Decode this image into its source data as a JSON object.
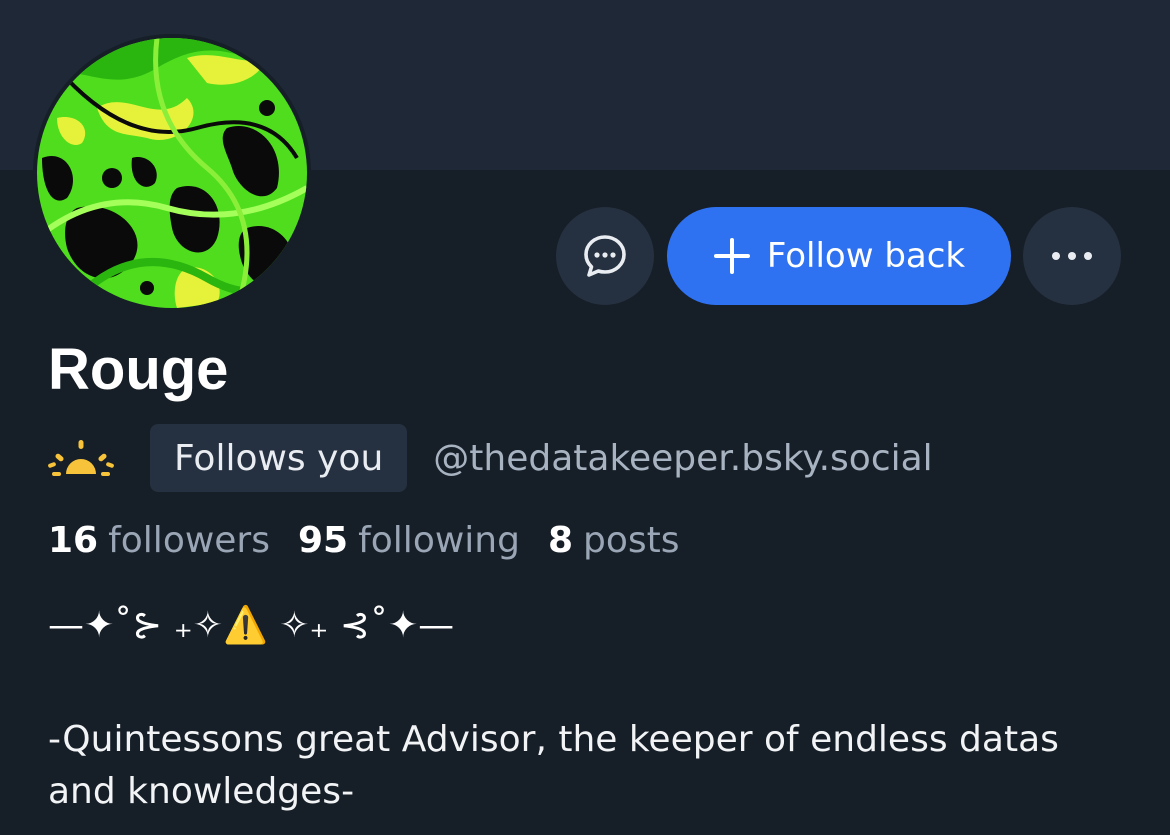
{
  "profile": {
    "display_name": "Rouge",
    "handle": "@thedatakeeper.bsky.social",
    "follows_you_label": "Follows you",
    "avatar_icon": "abstract-green-avatar",
    "status_icon": "sunrise-icon"
  },
  "actions": {
    "message_icon": "chat-bubble-icon",
    "follow_label": "Follow back",
    "follow_icon": "plus-icon",
    "more_icon": "ellipsis-icon"
  },
  "stats": {
    "followers_count": "16",
    "followers_label": "followers",
    "following_count": "95",
    "following_label": "following",
    "posts_count": "8",
    "posts_label": "posts"
  },
  "bio": {
    "decoration": "—✦˚⊱ ₊✧⚠️ ✧₊ ⊰˚✦—",
    "text": "-Quintessons great Advisor, the keeper of endless datas and knowledges-"
  },
  "colors": {
    "background": "#161e27",
    "banner": "#1e2837",
    "accent": "#2f72f1",
    "chip": "#253040"
  }
}
